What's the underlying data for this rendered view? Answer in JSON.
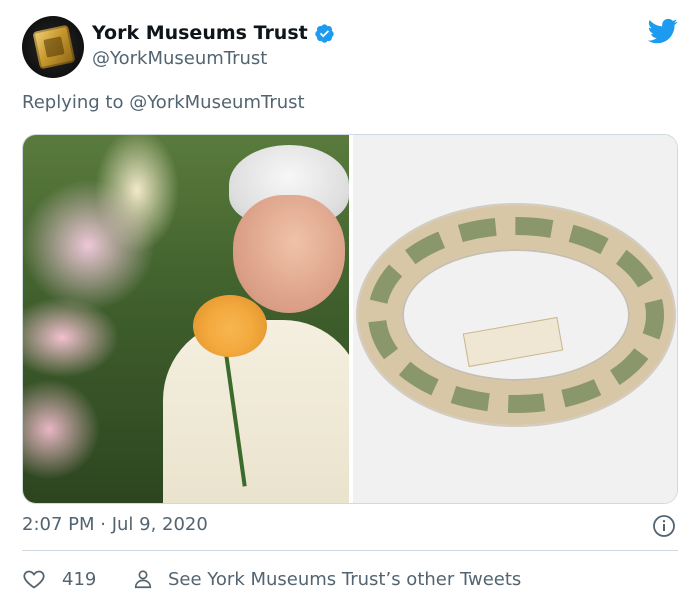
{
  "tweet": {
    "author_name": "York Museums Trust",
    "author_handle": "@YorkMuseumTrust",
    "replying_prefix": "Replying to ",
    "replying_to": "@YorkMuseumTrust",
    "timestamp": "2:07 PM · Jul 9, 2020",
    "like_count": "419",
    "other_tweets_text": "See York Museums Trust’s other Tweets"
  },
  "icons": {
    "verified": "verified-badge-icon",
    "brand": "twitter-bird-icon",
    "info": "info-icon",
    "like": "heart-icon",
    "profile": "person-icon"
  },
  "colors": {
    "brand_blue": "#1d9bf0",
    "muted_text": "#536471",
    "primary_text": "#0f1419",
    "border": "#cfd9de"
  }
}
